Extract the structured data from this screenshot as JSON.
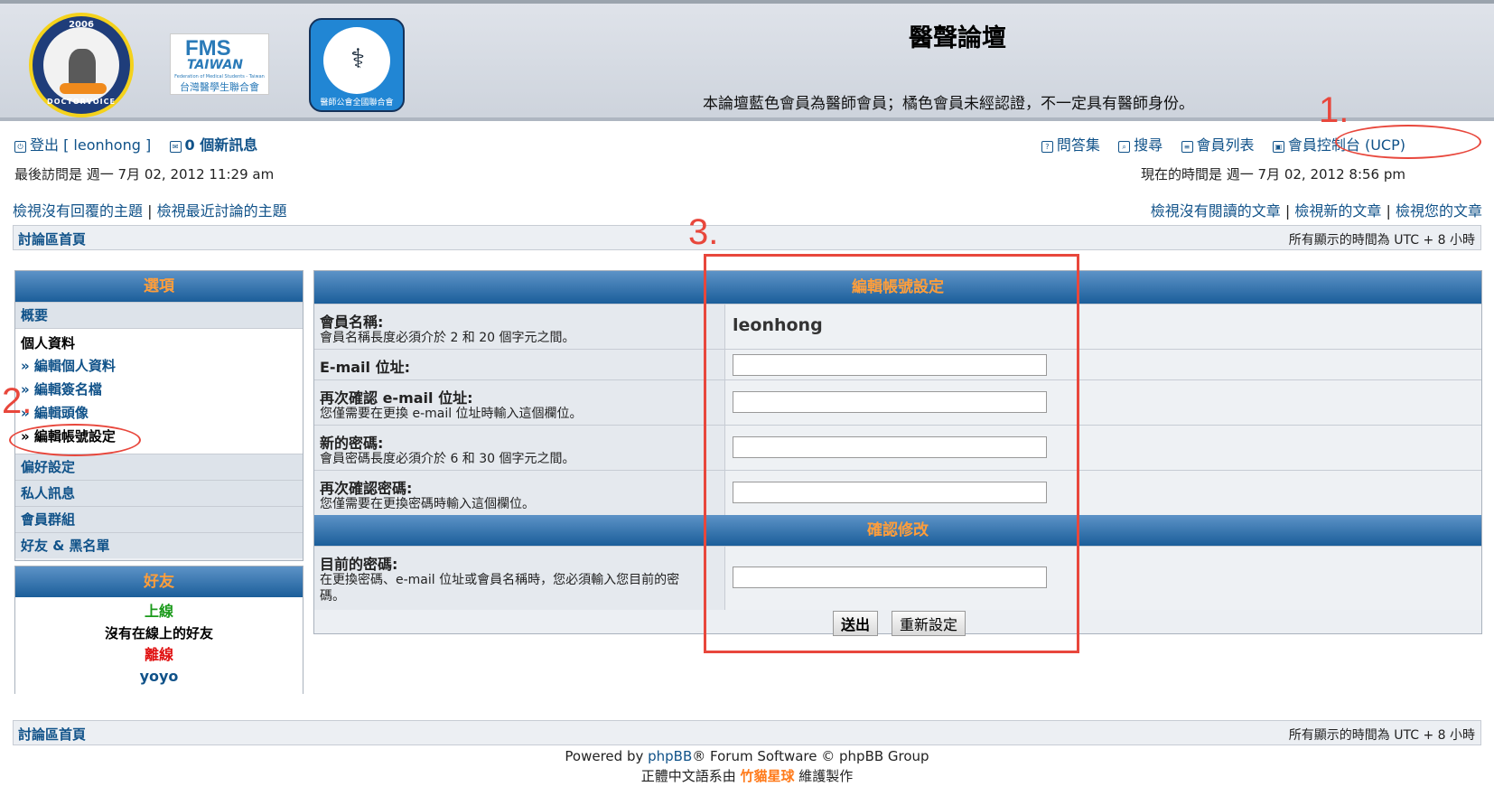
{
  "header": {
    "title": "醫聲論壇",
    "description": "本論壇藍色會員為醫師會員；橘色會員未經認證，不一定具有醫師身份。",
    "logos": {
      "doctorvoice_year": "2006",
      "doctorvoice_name": "DOCTORVOICE",
      "fms_big": "FMS",
      "fms_mid": "TAIWAN",
      "fms_small": "Federation of Medical Students - Taiwan",
      "fms_cn": "台灣醫學生聯合會",
      "tma_caption": "醫師公會全國聯合會"
    }
  },
  "topnav": {
    "logout": "登出 [ leonhong ]",
    "new_messages": "0 個新訊息",
    "faq": "問答集",
    "search": "搜尋",
    "members": "會員列表",
    "ucp": "會員控制台 (UCP)",
    "last_visit": "最後訪問是 週一 7月 02, 2012 11:29 am",
    "current_time": "現在的時間是 週一 7月 02, 2012 8:56 pm",
    "unanswered": "檢視沒有回覆的主題",
    "active_topics": "檢視最近討論的主題",
    "unread": "檢視沒有閱讀的文章",
    "new_posts": "檢視新的文章",
    "your_posts": "檢視您的文章",
    "separator": "|"
  },
  "breadcrumb": {
    "home": "討論區首頁",
    "timezone": "所有顯示的時間為 UTC + 8 小時"
  },
  "sidebar": {
    "options_title": "選項",
    "overview": "概要",
    "profile_title": "個人資料",
    "profile_items": [
      "» 編輯個人資料",
      "» 編輯簽名檔",
      "» 編輯頭像",
      "» 編輯帳號設定"
    ],
    "prefs": "偏好設定",
    "pm": "私人訊息",
    "groups": "會員群組",
    "friends_foes": "好友 & 黑名單",
    "friends_title": "好友",
    "online": "上線",
    "no_online": "沒有在線上的好友",
    "offline": "離線",
    "offline_friend": "yoyo"
  },
  "form": {
    "title": "編輯帳號設定",
    "username_label": "會員名稱:",
    "username_desc": "會員名稱長度必須介於 2 和 20 個字元之間。",
    "username_value": "leonhong",
    "email_label": "E-mail 位址:",
    "email_value": "",
    "email_confirm_label": "再次確認 e-mail 位址:",
    "email_confirm_desc": "您僅需要在更換 e-mail 位址時輸入這個欄位。",
    "email_confirm_value": "",
    "new_password_label": "新的密碼:",
    "new_password_desc": "會員密碼長度必須介於 6 和 30 個字元之間。",
    "new_password_value": "",
    "confirm_password_label": "再次確認密碼:",
    "confirm_password_desc": "您僅需要在更換密碼時輸入這個欄位。",
    "confirm_password_value": "",
    "confirm_title": "確認修改",
    "current_password_label": "目前的密碼:",
    "current_password_desc": "在更換密碼、e-mail 位址或會員名稱時，您必須輸入您目前的密碼。",
    "current_password_value": "",
    "submit": "送出",
    "reset": "重新設定"
  },
  "annotations": {
    "step1": "1.",
    "step2": "2.",
    "step3": "3."
  },
  "footer": {
    "home": "討論區首頁",
    "timezone": "所有顯示的時間為 UTC + 8 小時",
    "powered_prefix": "Powered by ",
    "powered_link": "phpBB",
    "powered_suffix": "® Forum Software © phpBB Group",
    "translation_prefix": "正體中文語系由 ",
    "translation_link": "竹貓星球",
    "translation_suffix": " 維護製作"
  },
  "colors": {
    "accent_orange": "#ff9e3b",
    "link_blue": "#105289",
    "annotation_red": "#e8473c",
    "online_green": "#1a9a1a",
    "offline_red": "#e01010"
  }
}
